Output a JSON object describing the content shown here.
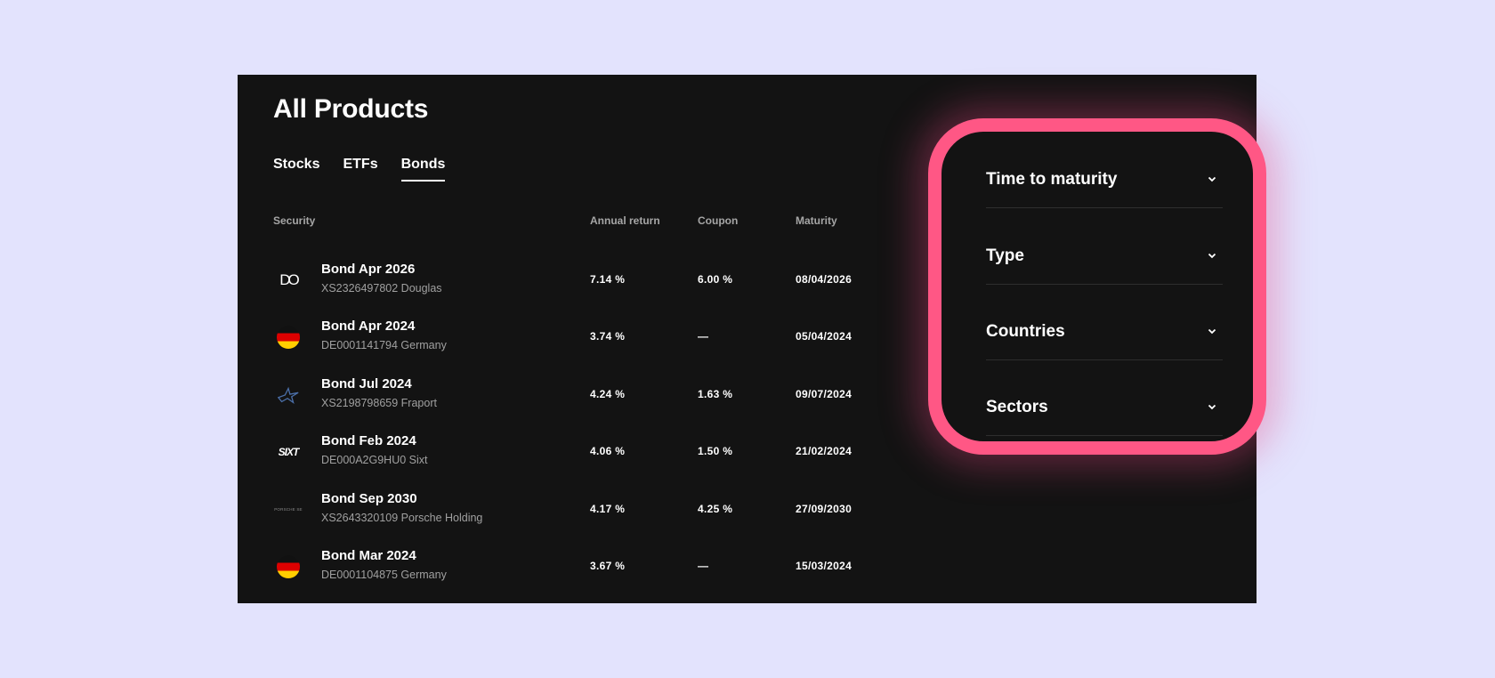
{
  "page_title": "All Products",
  "tabs": [
    {
      "label": "Stocks"
    },
    {
      "label": "ETFs"
    },
    {
      "label": "Bonds"
    }
  ],
  "active_tab": "Bonds",
  "table": {
    "headers": {
      "security": "Security",
      "annual_return": "Annual return",
      "coupon": "Coupon",
      "maturity": "Maturity"
    },
    "rows": [
      {
        "logo": "douglas-logo",
        "logo_text": "DO",
        "name": "Bond Apr 2026",
        "sub": "XS2326497802 Douglas",
        "annual_return": "7.14 %",
        "coupon": "6.00 %",
        "maturity": "08/04/2026"
      },
      {
        "logo": "germany-flag",
        "logo_text": "",
        "name": "Bond Apr 2024",
        "sub": "DE0001141794 Germany",
        "annual_return": "3.74 %",
        "coupon": "—",
        "maturity": "05/04/2024"
      },
      {
        "logo": "fraport-logo",
        "logo_text": "",
        "name": "Bond Jul 2024",
        "sub": "XS2198798659 Fraport",
        "annual_return": "4.24 %",
        "coupon": "1.63 %",
        "maturity": "09/07/2024"
      },
      {
        "logo": "sixt-logo",
        "logo_text": "SIXT",
        "name": "Bond Feb 2024",
        "sub": "DE000A2G9HU0 Sixt",
        "annual_return": "4.06 %",
        "coupon": "1.50 %",
        "maturity": "21/02/2024"
      },
      {
        "logo": "porsche-logo",
        "logo_text": "PORSCHE SE",
        "name": "Bond Sep 2030",
        "sub": "XS2643320109 Porsche Holding",
        "annual_return": "4.17 %",
        "coupon": "4.25 %",
        "maturity": "27/09/2030"
      },
      {
        "logo": "germany-flag",
        "logo_text": "",
        "name": "Bond Mar 2024",
        "sub": "DE0001104875 Germany",
        "annual_return": "3.67 %",
        "coupon": "—",
        "maturity": "15/03/2024"
      }
    ]
  },
  "filters": [
    {
      "label": "Time to maturity",
      "icon": "chevron-down-icon"
    },
    {
      "label": "Type",
      "icon": "chevron-down-icon"
    },
    {
      "label": "Countries",
      "icon": "chevron-down-icon"
    },
    {
      "label": "Sectors",
      "icon": "chevron-down-icon"
    }
  ],
  "colors": {
    "background": "#e3e3fd",
    "panel": "#131313",
    "highlight": "#ff5785"
  }
}
